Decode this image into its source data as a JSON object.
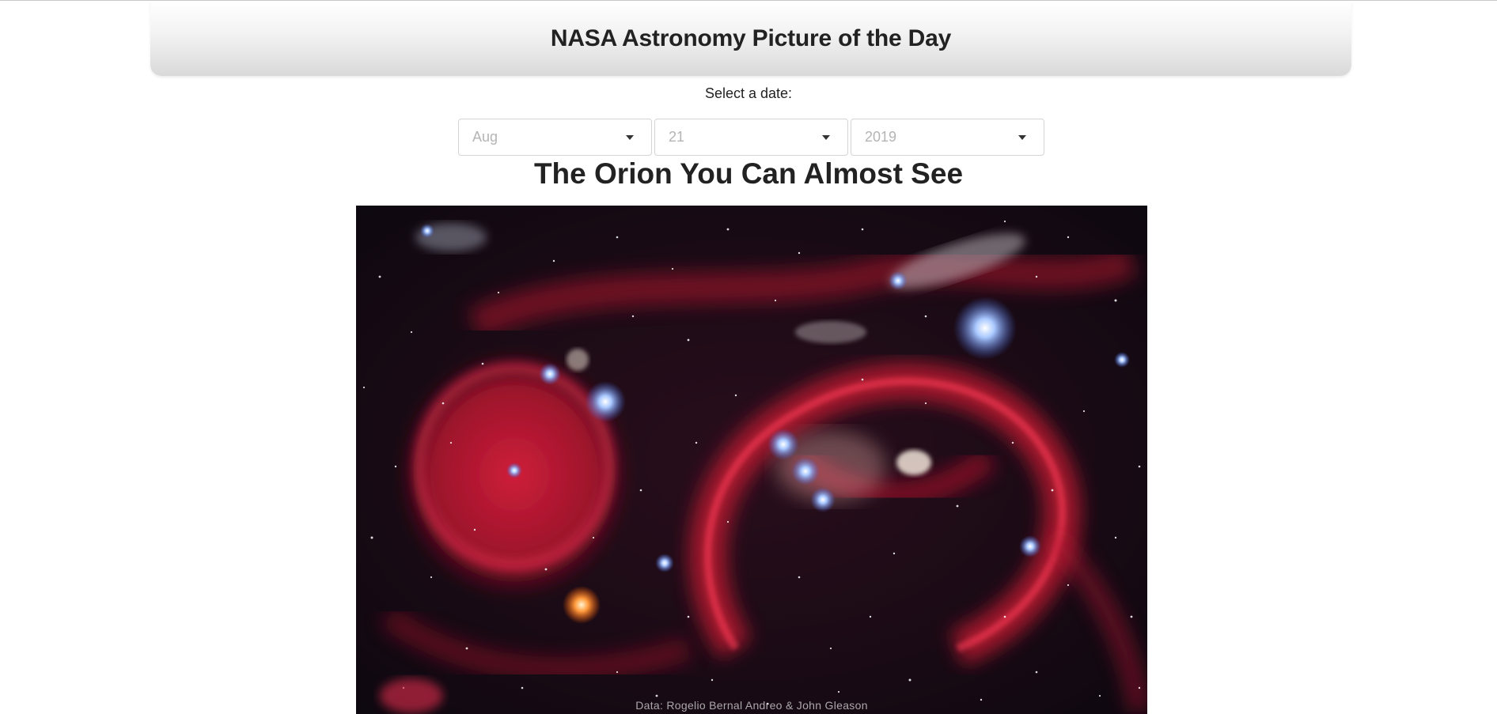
{
  "header": {
    "title": "NASA Astronomy Picture of the Day"
  },
  "date_picker": {
    "label": "Select a date:",
    "month": "Aug",
    "day": "21",
    "year": "2019"
  },
  "apod": {
    "title": "The Orion You Can Almost See",
    "image_credit": "Data: Rogelio Bernal Andreo & John Gleason"
  },
  "colors": {
    "header_gradient_top": "#ffffff",
    "header_gradient_bottom": "#d9d9d9",
    "placeholder_text": "#b4b4b4",
    "nebula_red": "#c8102e",
    "space_background": "#120b14"
  },
  "icons": {
    "select_caret": "caret-down-icon"
  }
}
